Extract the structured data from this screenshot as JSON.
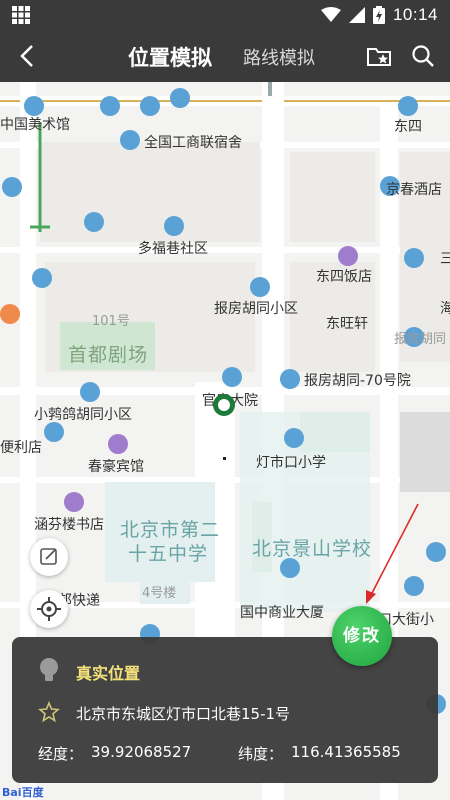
{
  "status_bar": {
    "time": "10:14"
  },
  "top_bar": {
    "tab_active": "位置模拟",
    "tab_inactive": "路线模拟"
  },
  "map": {
    "labels": {
      "zhongguo_meishuguan": "中国美术馆",
      "dongsi": "东四",
      "quanguo_gongshang": "全国工商联宿舍",
      "jingchun_jiudian": "京春酒店",
      "duofuxiang": "多福巷社区",
      "dongsi_fandian": "东四饭店",
      "san": "三",
      "baofang_hutong": "报房胡同小区",
      "dongwangxuan": "东旺轩",
      "hai": "海",
      "no101": "101号",
      "baofang_hutong_grey": "报房胡同",
      "shoudu_juchang": "首都剧场",
      "guanfu_dayuan": "官房大院",
      "baofang_70": "报房胡同-70号院",
      "xiaojiuge": "小鹁鸽胡同小区",
      "bianlidian": "便利店",
      "dengshikou_xiaoxue": "灯市口小学",
      "chunhao_binguan": "春豪宾馆",
      "hanfen_shudian": "涵芬楼书店",
      "beijing25_a": "北京市第二",
      "beijing25_b": "十五中学",
      "jingshan_xuexiao": "北京景山学校",
      "no4": "4号楼",
      "bang_kuaidi": "邦快递",
      "guozhong_dasha": "国中商业大厦",
      "kou_dajie": "口大街小"
    },
    "baidu_logo": "Bai百度"
  },
  "info_panel": {
    "title": "真实位置",
    "address": "北京市东城区灯市口北巷15-1号",
    "lng_label": "经度：",
    "lng_value": "39.92068527",
    "lat_label": "纬度：",
    "lat_value": "116.41365585"
  },
  "modify_button": {
    "label": "修改"
  },
  "colors": {
    "toolbar": "#3a3a3a",
    "marker": "#1e7a3a",
    "modify": "#28b24a",
    "title_yellow": "#f5e27a"
  }
}
